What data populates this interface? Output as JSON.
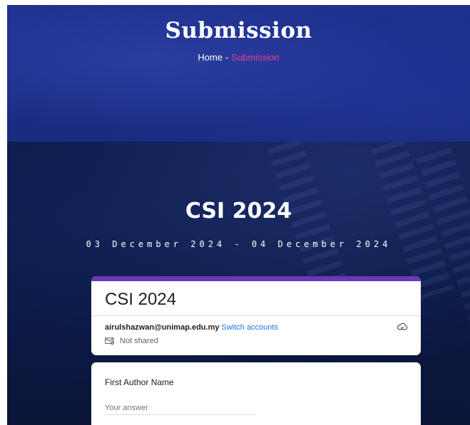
{
  "hero": {
    "title": "Submission",
    "breadcrumb": {
      "home": "Home",
      "separator": "-",
      "current": "Submission"
    }
  },
  "conference": {
    "title": "CSI 2024",
    "dates": "03 December 2024 - 04 December 2024"
  },
  "form": {
    "title": "CSI 2024",
    "account_email": "airulshazwan@unimap.edu.my",
    "switch_accounts": "Switch accounts",
    "sharing_status": "Not shared",
    "questions": [
      {
        "label": "First Author Name",
        "placeholder": "Your answer"
      }
    ]
  },
  "colors": {
    "accent": "#673ab7",
    "breadcrumb_current": "#e83e8c",
    "link": "#1a73e8",
    "hero_bg": "#1c2f8f",
    "dark_bg": "#0c1a4a"
  },
  "icons": {
    "cloud": "cloud-check-icon",
    "not_shared": "not-shared-icon"
  }
}
